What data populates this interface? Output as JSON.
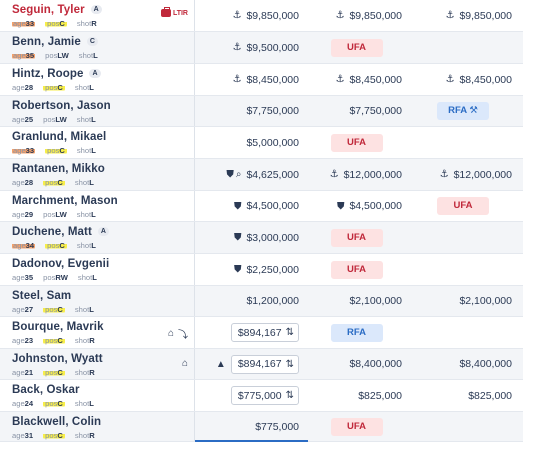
{
  "players": [
    {
      "name": "Seguin, Tyler",
      "name_color": "red",
      "role": "A",
      "age": "33",
      "pos": "C",
      "shot": "R",
      "age_hl": true,
      "pos_hl": true,
      "flags": "LTIR",
      "cells": [
        {
          "icon": "anchor-icon",
          "value": "$9,850,000"
        },
        {
          "icon": "anchor-icon",
          "value": "$9,850,000"
        },
        {
          "icon": "anchor-icon",
          "value": "$9,850,000"
        }
      ]
    },
    {
      "name": "Benn, Jamie",
      "role": "C",
      "age": "35",
      "pos": "LW",
      "shot": "L",
      "age_hl": true,
      "pos_hl": false,
      "cells": [
        {
          "icon": "anchor-icon",
          "value": "$9,500,000"
        },
        {
          "badge": "UFA"
        },
        {}
      ]
    },
    {
      "name": "Hintz, Roope",
      "role": "A",
      "age": "28",
      "pos": "C",
      "shot": "L",
      "age_hl": false,
      "pos_hl": true,
      "cells": [
        {
          "icon": "anchor-icon",
          "value": "$8,450,000"
        },
        {
          "icon": "anchor-icon",
          "value": "$8,450,000"
        },
        {
          "icon": "anchor-icon",
          "value": "$8,450,000"
        }
      ]
    },
    {
      "name": "Robertson, Jason",
      "age": "25",
      "pos": "LW",
      "shot": "L",
      "age_hl": false,
      "pos_hl": false,
      "cells": [
        {
          "value": "$7,750,000"
        },
        {
          "value": "$7,750,000"
        },
        {
          "badge": "RFA",
          "arb": true
        }
      ]
    },
    {
      "name": "Granlund, Mikael",
      "age": "33",
      "pos": "C",
      "shot": "L",
      "age_hl": true,
      "pos_hl": true,
      "cells": [
        {
          "value": "$5,000,000"
        },
        {
          "badge": "UFA"
        },
        {}
      ]
    },
    {
      "name": "Rantanen, Mikko",
      "age": "28",
      "pos": "C",
      "shot": "L",
      "age_hl": false,
      "pos_hl": true,
      "cells": [
        {
          "icon": "shield-search-icon",
          "value": "$4,625,000"
        },
        {
          "icon": "anchor-icon",
          "value": "$12,000,000"
        },
        {
          "icon": "anchor-icon",
          "value": "$12,000,000"
        }
      ]
    },
    {
      "name": "Marchment, Mason",
      "age": "29",
      "pos": "LW",
      "shot": "L",
      "age_hl": false,
      "pos_hl": false,
      "cells": [
        {
          "icon": "shield-icon",
          "value": "$4,500,000"
        },
        {
          "icon": "shield-icon",
          "value": "$4,500,000"
        },
        {
          "badge": "UFA"
        }
      ]
    },
    {
      "name": "Duchene, Matt",
      "role": "A",
      "age": "34",
      "pos": "C",
      "shot": "L",
      "age_hl": true,
      "pos_hl": true,
      "cells": [
        {
          "icon": "shield-full-icon",
          "value": "$3,000,000"
        },
        {
          "badge": "UFA"
        },
        {}
      ]
    },
    {
      "name": "Dadonov, Evgenii",
      "age": "35",
      "pos": "RW",
      "shot": "L",
      "age_hl": false,
      "pos_hl": false,
      "cells": [
        {
          "icon": "shield-icon",
          "value": "$2,250,000"
        },
        {
          "badge": "UFA"
        },
        {}
      ]
    },
    {
      "name": "Steel, Sam",
      "age": "27",
      "pos": "C",
      "shot": "L",
      "age_hl": false,
      "pos_hl": true,
      "cells": [
        {
          "value": "$1,200,000"
        },
        {
          "value": "$2,100,000"
        },
        {
          "value": "$2,100,000"
        }
      ]
    },
    {
      "name": "Bourque, Mavrik",
      "age": "23",
      "pos": "C",
      "shot": "R",
      "age_hl": false,
      "pos_hl": true,
      "flags": "grad-arrow",
      "cells": [
        {
          "pill": true,
          "value": "$894,167"
        },
        {
          "badge": "RFA"
        },
        {}
      ]
    },
    {
      "name": "Johnston, Wyatt",
      "age": "21",
      "pos": "C",
      "shot": "R",
      "age_hl": false,
      "pos_hl": true,
      "flags": "grad",
      "cells": [
        {
          "icon": "money-bag-icon",
          "pill": true,
          "value": "$894,167"
        },
        {
          "value": "$8,400,000"
        },
        {
          "value": "$8,400,000"
        }
      ]
    },
    {
      "name": "Back, Oskar",
      "age": "24",
      "pos": "C",
      "shot": "L",
      "age_hl": false,
      "pos_hl": true,
      "cells": [
        {
          "pill": true,
          "value": "$775,000"
        },
        {
          "value": "$825,000"
        },
        {
          "value": "$825,000"
        }
      ]
    },
    {
      "name": "Blackwell, Colin",
      "age": "31",
      "pos": "C",
      "shot": "R",
      "age_hl": false,
      "pos_hl": true,
      "cells": [
        {
          "value": "$775,000"
        },
        {
          "badge": "UFA"
        },
        {}
      ]
    }
  ],
  "labels": {
    "age": "age",
    "pos": "pos",
    "shot": "shot",
    "ltir": "LTIR"
  },
  "colors": {
    "ufa_bg": "#fde2e2",
    "ufa_fg": "#c0283a",
    "rfa_bg": "#dbe8fb",
    "rfa_fg": "#2b6cc4",
    "highlight_yellow": "#f7ee4a",
    "highlight_orange": "#f6a26b"
  }
}
